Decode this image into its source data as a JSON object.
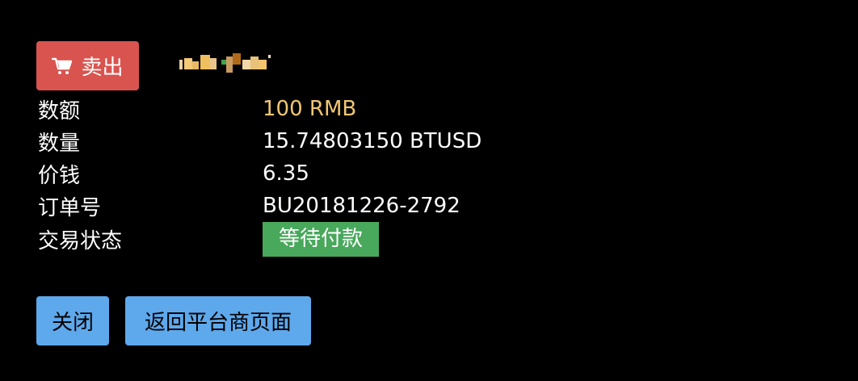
{
  "header": {
    "sell_label": "卖出",
    "sell_color": "#d9534f"
  },
  "details": [
    {
      "label": "数额",
      "value": "100 RMB"
    },
    {
      "label": "数量",
      "value": "15.74803150 BTUSD"
    },
    {
      "label": "价钱",
      "value": "6.35"
    },
    {
      "label": "订单号",
      "value": "BU20181226-2792"
    },
    {
      "label": "交易状态",
      "value": "等待付款"
    }
  ],
  "colors": {
    "amount": "#f0c674",
    "status_badge": "#48a85c",
    "button": "#5ea8ec"
  },
  "buttons": {
    "close_label": "关闭",
    "return_label": "返回平台商页面"
  },
  "icons": {
    "sell": "shopping-cart-icon"
  }
}
